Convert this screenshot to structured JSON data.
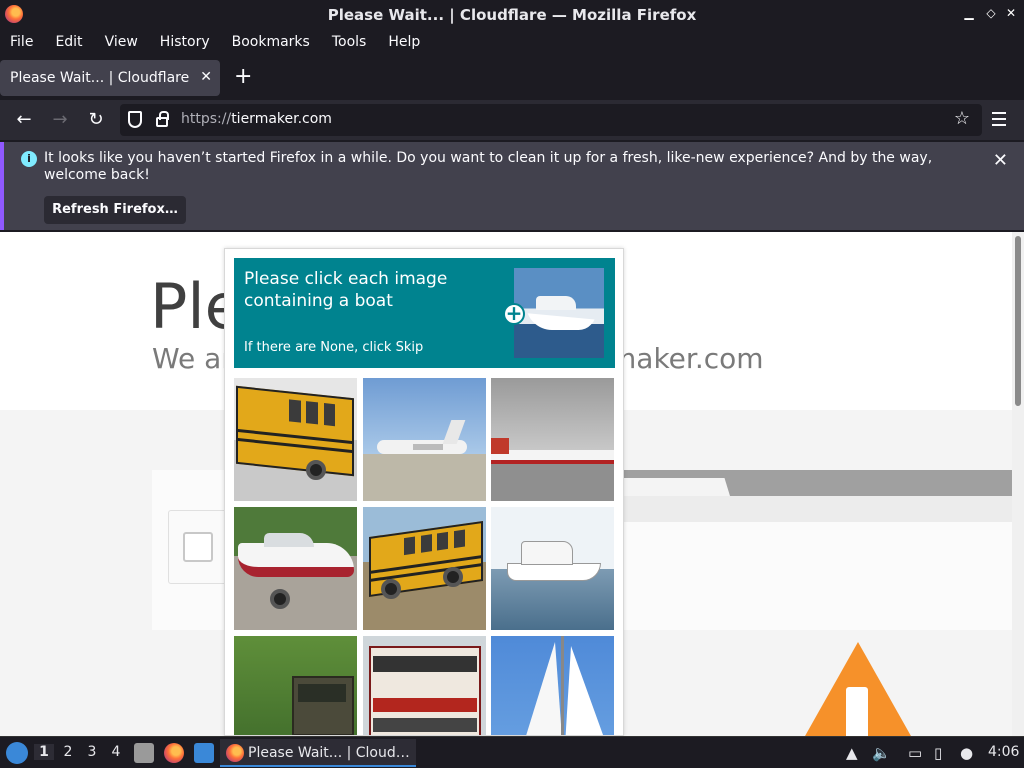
{
  "window": {
    "title": "Please Wait... | Cloudflare — Mozilla Firefox",
    "controls": [
      "minimize-icon",
      "maximize-icon",
      "close-icon"
    ]
  },
  "menubar": {
    "items": [
      {
        "label": "File",
        "accel": "F"
      },
      {
        "label": "Edit",
        "accel": "E"
      },
      {
        "label": "View",
        "accel": "V"
      },
      {
        "label": "History",
        "accel": "s"
      },
      {
        "label": "Bookmarks",
        "accel": "B"
      },
      {
        "label": "Tools",
        "accel": "T"
      },
      {
        "label": "Help",
        "accel": "H"
      }
    ]
  },
  "tabs": [
    {
      "label": "Please Wait... | Cloudflare",
      "active": true
    }
  ],
  "navbar": {
    "url_scheme": "https://",
    "url_host": "tiermaker.com"
  },
  "notification": {
    "message": "It looks like you haven’t started Firefox in a while. Do you want to clean it up for a fresh, like-new experience? And by the way, welcome back!",
    "button_label": "Refresh Firefox…"
  },
  "page": {
    "title_visible": "Ple",
    "subtitle_left": "We ar",
    "subtitle_right": "rmaker.com"
  },
  "captcha": {
    "prompt": "Please click each image containing a boat",
    "hint": "If there are None, click Skip",
    "accent_color": "#00838f",
    "tiles": [
      {
        "subject": "school bus"
      },
      {
        "subject": "airplane on tarmac"
      },
      {
        "subject": "airplane"
      },
      {
        "subject": "speedboat on trailer"
      },
      {
        "subject": "school bus"
      },
      {
        "subject": "boat on water"
      },
      {
        "subject": "vehicle in trees"
      },
      {
        "subject": "double-decker bus"
      },
      {
        "subject": "sailboat"
      }
    ]
  },
  "taskbar": {
    "workspaces": [
      "1",
      "2",
      "3",
      "4"
    ],
    "active_workspace": "1",
    "task_label": "Please Wait... | Cloud…",
    "clock": "4:06"
  }
}
